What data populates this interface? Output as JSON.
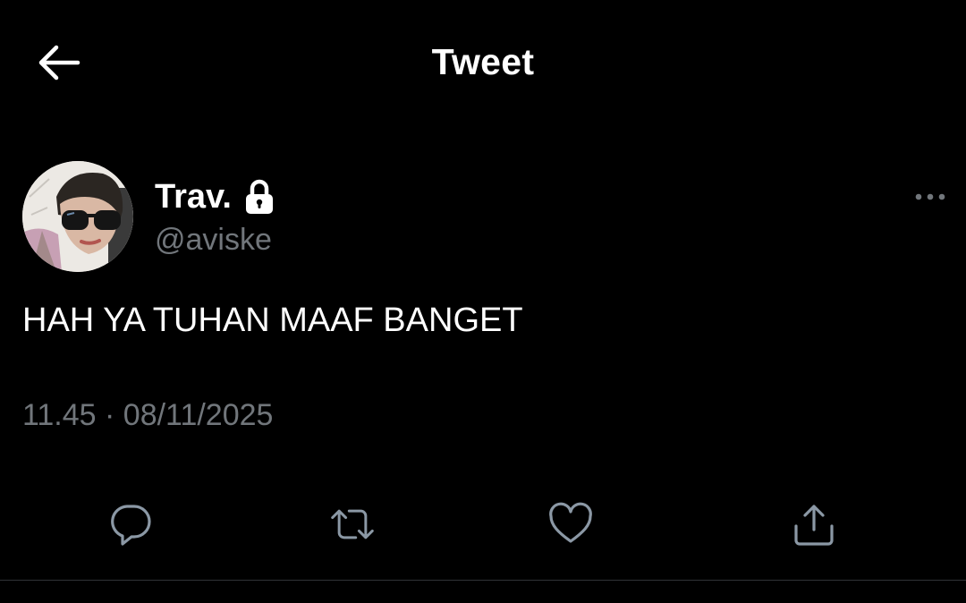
{
  "header": {
    "title": "Tweet",
    "back_icon": "arrow-left-icon"
  },
  "tweet": {
    "author": {
      "display_name": "Trav.",
      "handle": "@aviske",
      "protected_icon": "lock-icon",
      "avatar_icon": "avatar-photo"
    },
    "more_icon": "more-horizontal-icon",
    "text": "HAH YA TUHAN MAAF BANGET",
    "time": "11.45",
    "separator": "·",
    "date": "08/11/2025",
    "actions": [
      {
        "icon": "reply-icon"
      },
      {
        "icon": "retweet-icon"
      },
      {
        "icon": "like-icon"
      },
      {
        "icon": "share-icon"
      }
    ]
  },
  "colors": {
    "background": "#000000",
    "primary_text": "#ffffff",
    "secondary_text": "#71767b",
    "icon": "#8b98a5",
    "divider": "#2f3336"
  }
}
